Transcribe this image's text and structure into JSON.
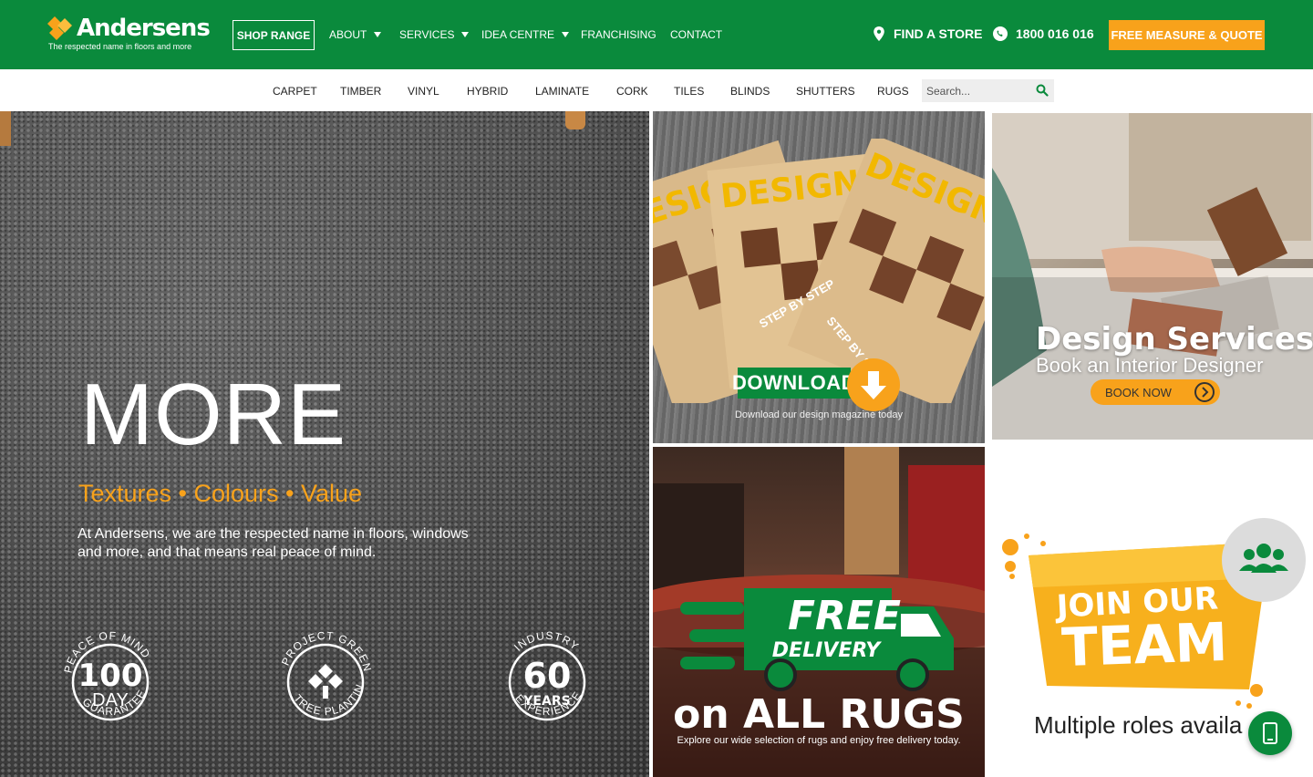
{
  "header": {
    "logo_name": "Andersens",
    "logo_tagline": "The respected name in floors and more",
    "shop_range": "SHOP RANGE",
    "nav": [
      {
        "label": "ABOUT",
        "dropdown": true
      },
      {
        "label": "SERVICES",
        "dropdown": true
      },
      {
        "label": "IDEA CENTRE",
        "dropdown": true
      },
      {
        "label": "FRANCHISING",
        "dropdown": false
      },
      {
        "label": "CONTACT",
        "dropdown": false
      }
    ],
    "find_store": "FIND A STORE",
    "phone": "1800 016 016",
    "quote_button": "FREE MEASURE & QUOTE"
  },
  "categories": [
    "CARPET",
    "TIMBER",
    "VINYL",
    "HYBRID",
    "LAMINATE",
    "CORK",
    "TILES",
    "BLINDS",
    "SHUTTERS",
    "RUGS"
  ],
  "search": {
    "placeholder": "Search..."
  },
  "hero": {
    "title": "MORE",
    "subtitle": "Textures • Colours • Value",
    "description": "At Andersens, we are the respected name in floors, windows and more, and that means real peace of mind.",
    "badges": [
      {
        "arc_top": "PEACE OF MIND",
        "big": "100",
        "small": "DAY",
        "arc_bottom": "GUARANTEE"
      },
      {
        "arc_top": "PROJECT GREEN",
        "arc_bottom": "TREE PLANTING"
      },
      {
        "arc_top": "INDUSTRY",
        "big": "60",
        "small": "YEARS",
        "arc_bottom": "EXPERIENCE"
      }
    ]
  },
  "tiles": {
    "download": {
      "magazine_word": "DESIGN",
      "step_text": "STEP BY STEP",
      "button": "DOWNLOAD",
      "caption": "Download our design magazine today"
    },
    "design": {
      "title": "Design Services",
      "subtitle": "Book an Interior Designer",
      "button": "BOOK NOW"
    },
    "rugs": {
      "free": "FREE",
      "delivery": "DELIVERY",
      "title": "on ALL RUGS",
      "description": "Explore our wide selection of rugs and enjoy free delivery today."
    },
    "team": {
      "line1": "JOIN OUR",
      "line2": "TEAM",
      "roles": "Multiple roles availa"
    }
  },
  "colors": {
    "brand_green": "#0a8a3c",
    "accent_orange": "#f8a21b"
  }
}
